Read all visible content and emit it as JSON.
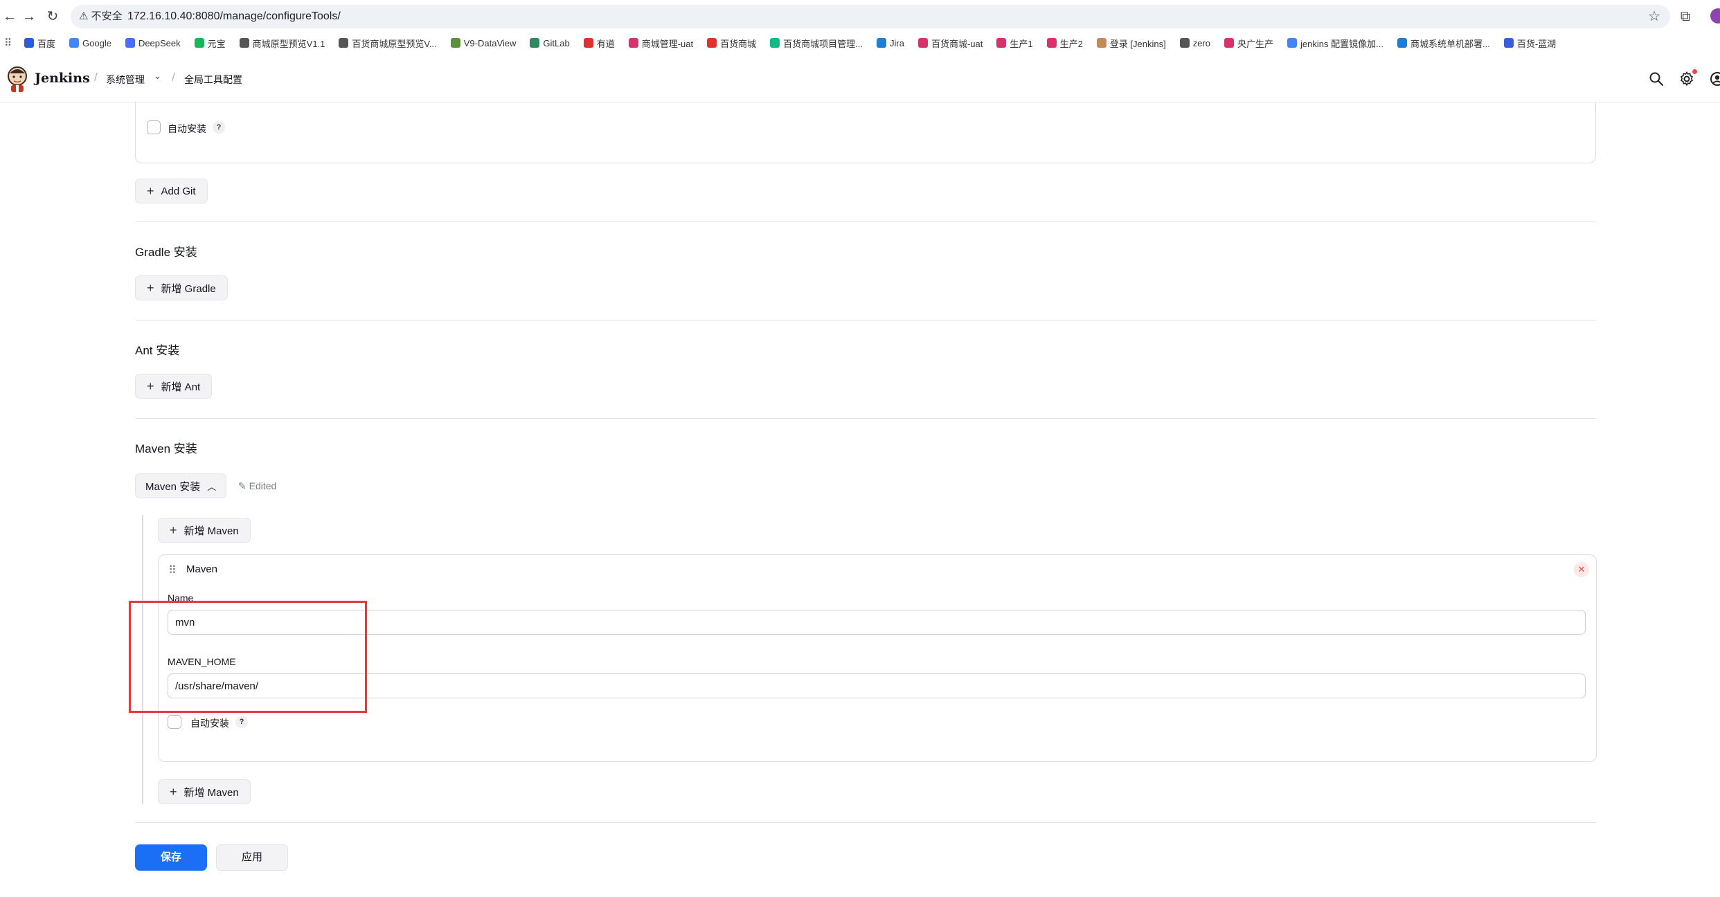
{
  "browser": {
    "url_warning": "不安全",
    "url": "172.16.10.40:8080/manage/configureTools/",
    "icons": [
      "back-icon",
      "forward-icon",
      "reload-icon",
      "star-icon",
      "extensions-icon"
    ],
    "bookmarks": [
      {
        "label": "百度",
        "color": "#2b5bde"
      },
      {
        "label": "Google",
        "color": "#4285f4"
      },
      {
        "label": "DeepSeek",
        "color": "#4d6bfe"
      },
      {
        "label": "元宝",
        "color": "#1bb55c"
      },
      {
        "label": "商城原型预览V1.1",
        "color": "#555555"
      },
      {
        "label": "百货商城原型预览V...",
        "color": "#555555"
      },
      {
        "label": "V9-DataView",
        "color": "#5a8f3c"
      },
      {
        "label": "GitLab",
        "color": "#2f8a5f"
      },
      {
        "label": "有道",
        "color": "#e03131"
      },
      {
        "label": "商城管理-uat",
        "color": "#d6336c"
      },
      {
        "label": "百货商城",
        "color": "#e03131"
      },
      {
        "label": "百货商城项目管理...",
        "color": "#12b886"
      },
      {
        "label": "Jira",
        "color": "#1c7ed6"
      },
      {
        "label": "百货商城-uat",
        "color": "#d6336c"
      },
      {
        "label": "生产1",
        "color": "#d6336c"
      },
      {
        "label": "生产2",
        "color": "#d6336c"
      },
      {
        "label": "登录 [Jenkins]",
        "color": "#c08a5a"
      },
      {
        "label": "zero",
        "color": "#555555"
      },
      {
        "label": "央广生产",
        "color": "#d6336c"
      },
      {
        "label": "jenkins 配置镜像加...",
        "color": "#4285f4"
      },
      {
        "label": "商城系统单机部署...",
        "color": "#1c7ed6"
      },
      {
        "label": "百货-蓝湖",
        "color": "#3b5bdb"
      }
    ]
  },
  "header": {
    "brand": "Jenkins",
    "breadcrumbs": [
      "系统管理",
      "全局工具配置"
    ]
  },
  "git": {
    "auto_install_label": "自动安装",
    "help": "?",
    "add_button": "Add Git"
  },
  "gradle": {
    "title": "Gradle 安装",
    "add_button": "新增 Gradle"
  },
  "ant": {
    "title": "Ant 安装",
    "add_button": "新增 Ant"
  },
  "maven": {
    "title": "Maven 安装",
    "toggle_label": "Maven 安装",
    "edited": "Edited",
    "add_button_top": "新增 Maven",
    "add_button_bottom": "新增 Maven",
    "card_title": "Maven",
    "name_label": "Name",
    "name_value": "mvn",
    "home_label": "MAVEN_HOME",
    "home_value": "/usr/share/maven/",
    "auto_install_label": "自动安装",
    "help": "?"
  },
  "actions": {
    "save": "保存",
    "apply": "应用"
  },
  "colors": {
    "primary": "#1b6ff5",
    "highlight": "#e33b3b",
    "danger": "#e5484d"
  }
}
